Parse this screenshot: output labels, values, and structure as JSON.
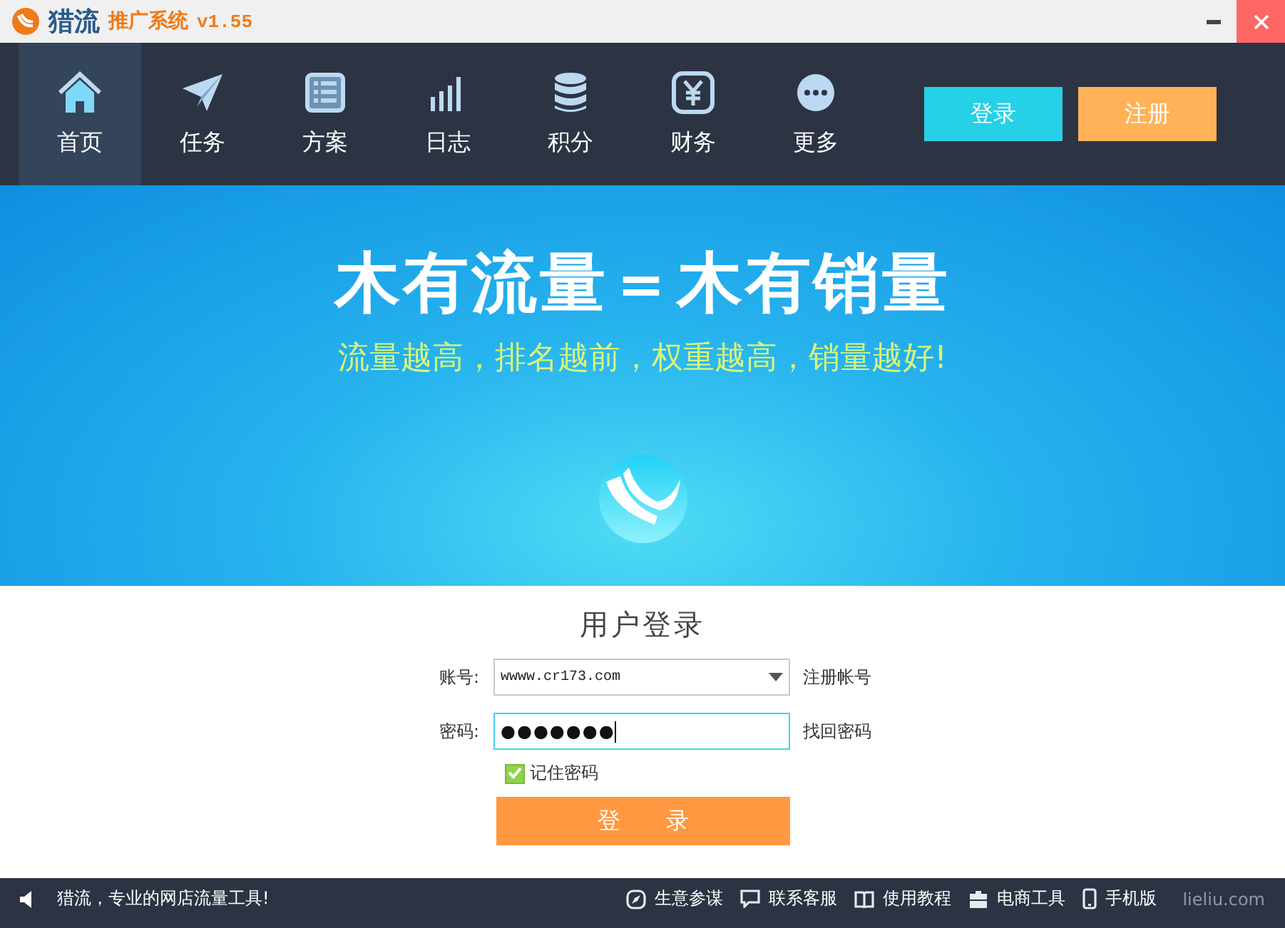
{
  "window": {
    "app_name": "猎流",
    "subtitle": "推广系统",
    "version": "v1.55"
  },
  "nav": [
    {
      "label": "首页",
      "kind": "home",
      "selected": true
    },
    {
      "label": "任务",
      "kind": "plane",
      "selected": false
    },
    {
      "label": "方案",
      "kind": "sheet",
      "selected": false
    },
    {
      "label": "日志",
      "kind": "bars",
      "selected": false
    },
    {
      "label": "积分",
      "kind": "coins",
      "selected": false
    },
    {
      "label": "财务",
      "kind": "yen",
      "selected": false
    },
    {
      "label": "更多",
      "kind": "more",
      "selected": false
    }
  ],
  "auth_buttons": [
    {
      "label": "登录",
      "kind": "login"
    },
    {
      "label": "注册",
      "kind": "register"
    }
  ],
  "banner": {
    "headline": "木有流量＝木有销量",
    "tagline": "流量越高，排名越前，权重越高，销量越好!"
  },
  "login": {
    "title": "用户登录",
    "account": {
      "label": "账号:",
      "value": "wwww.cr173.com",
      "link": "注册帐号"
    },
    "password": {
      "label": "密码:",
      "value": "●●●●●●●",
      "link": "找回密码"
    },
    "remember": {
      "label": "记住密码",
      "checked": true
    },
    "submit": "登　　录"
  },
  "status_bar": {
    "message": "猎流，专业的网店流量工具!",
    "links": [
      {
        "label": "生意参谋",
        "kind": "compass"
      },
      {
        "label": "联系客服",
        "kind": "chat"
      },
      {
        "label": "使用教程",
        "kind": "book"
      },
      {
        "label": "电商工具",
        "kind": "toolbox"
      },
      {
        "label": "手机版",
        "kind": "phone"
      }
    ],
    "site": "lieliu.com"
  }
}
